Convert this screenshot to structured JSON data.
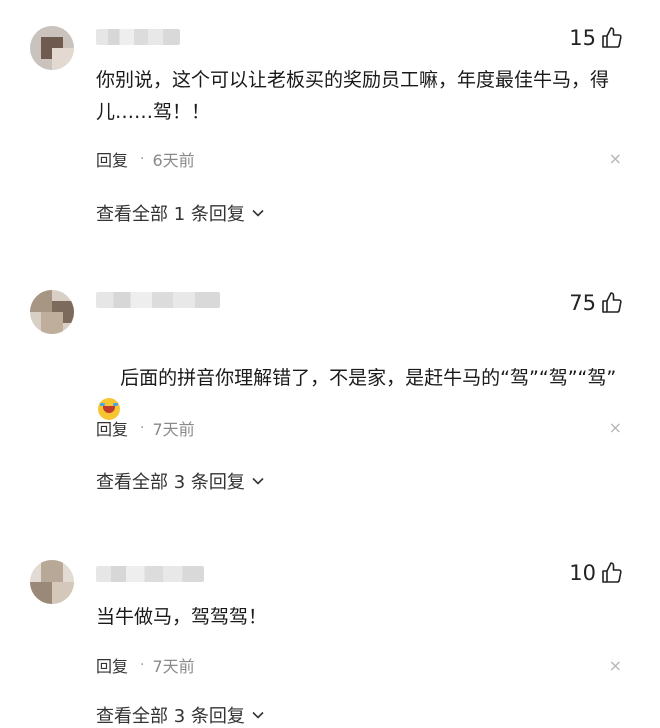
{
  "comments": [
    {
      "likes": "15",
      "text": "你别说，这个可以让老板买的奖励员工嘛，年度最佳牛马，得儿……驾！！",
      "reply_label": "回复",
      "dot": "·",
      "time": "6天前",
      "close": "×",
      "view_all": "查看全部 1 条回复"
    },
    {
      "likes": "75",
      "text": "后面的拼音你理解错了，不是家，是赶牛马的“驾”“驾”“驾”",
      "reply_label": "回复",
      "dot": "·",
      "time": "7天前",
      "close": "×",
      "view_all": "查看全部 3 条回复"
    },
    {
      "likes": "10",
      "text": "当牛做马，驾驾驾！",
      "reply_label": "回复",
      "dot": "·",
      "time": "7天前",
      "close": "×",
      "view_all": "查看全部 3 条回复"
    }
  ]
}
